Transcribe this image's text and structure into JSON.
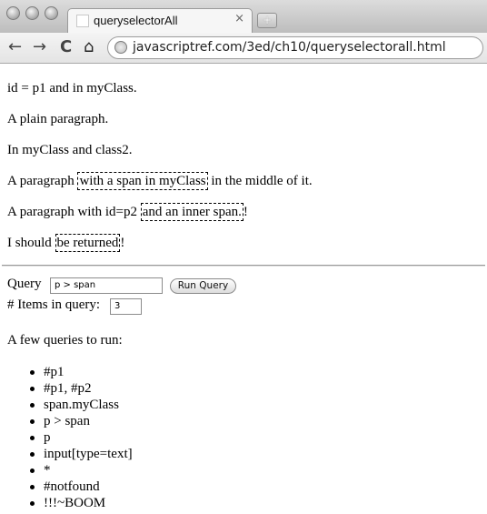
{
  "browser": {
    "tab_title": "queryselectorAll",
    "tab_close": "×",
    "new_tab": "+",
    "url": "javascriptref.com/3ed/ch10/queryselectorall.html",
    "back_icon": "←",
    "forward_icon": "→",
    "reload_icon": "C",
    "home_icon": "⌂"
  },
  "paragraphs": {
    "p1": "id = p1 and in myClass.",
    "p2": "A plain paragraph.",
    "p3": "In myClass and class2.",
    "p4_before": "A paragraph ",
    "p4_span": "with a span in myClass",
    "p4_after": " in the middle of it.",
    "p5_before": "A paragraph with id=p2 ",
    "p5_span": "and an inner span.",
    "p5_after": "!",
    "p6_before": "I should ",
    "p6_span": "be returned",
    "p6_after": "!"
  },
  "form": {
    "query_label": "Query",
    "query_value": "p > span",
    "run_button": "Run Query",
    "count_label": "# Items in query:",
    "count_value": "3"
  },
  "queries": {
    "heading": "A few queries to run:",
    "items": [
      "#p1",
      "#p1, #p2",
      "span.myClass",
      "p > span",
      "p",
      "input[type=text]",
      "*",
      "#notfound",
      "!!!~BOOM"
    ]
  }
}
